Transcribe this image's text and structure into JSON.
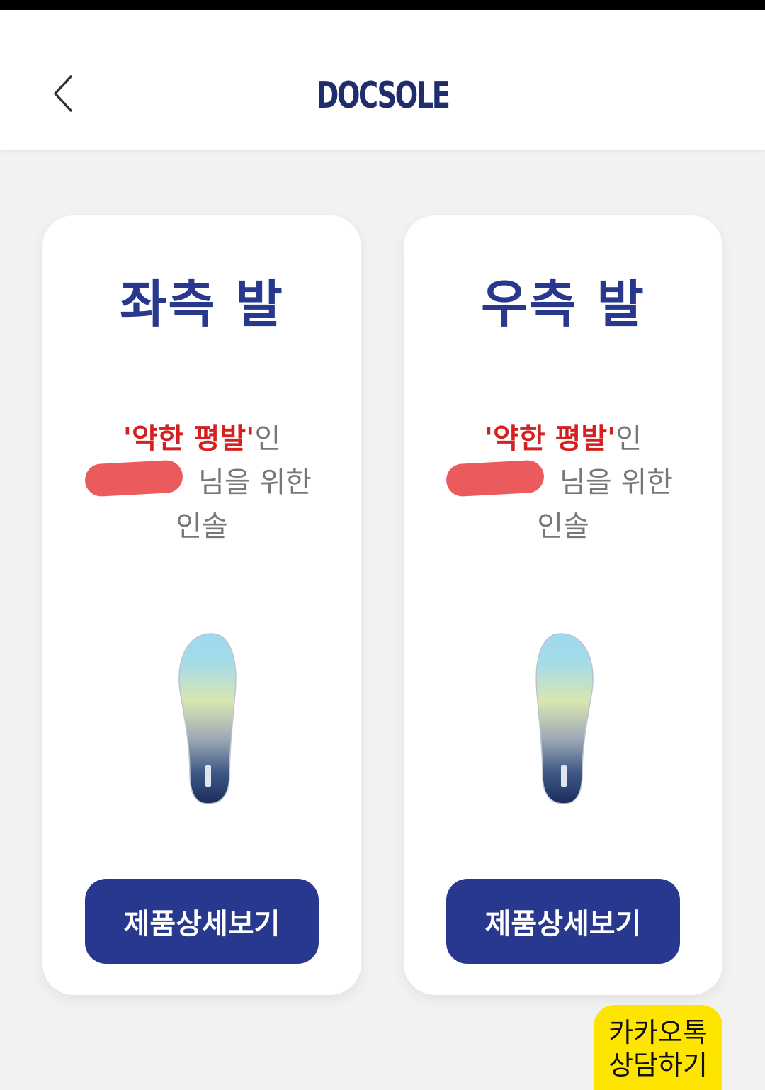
{
  "header": {
    "logo_text": "DOCSOLE"
  },
  "cards": [
    {
      "title": "좌측 발",
      "flat_label": "'약한 평발'",
      "suffix_in": "인",
      "name_suffix": "님을 위한",
      "insole_label": "인솔",
      "button_label": "제품상세보기"
    },
    {
      "title": "우측 발",
      "flat_label": "'약한 평발'",
      "suffix_in": "인",
      "name_suffix": "님을 위한",
      "insole_label": "인솔",
      "button_label": "제품상세보기"
    }
  ],
  "kakao": {
    "line1": "카카오톡",
    "line2": "상담하기"
  },
  "colors": {
    "brand_navy": "#27388e",
    "accent_red": "#d42020",
    "kakao_yellow": "#fee500"
  },
  "icons": {
    "back": "chevron-left-icon"
  }
}
